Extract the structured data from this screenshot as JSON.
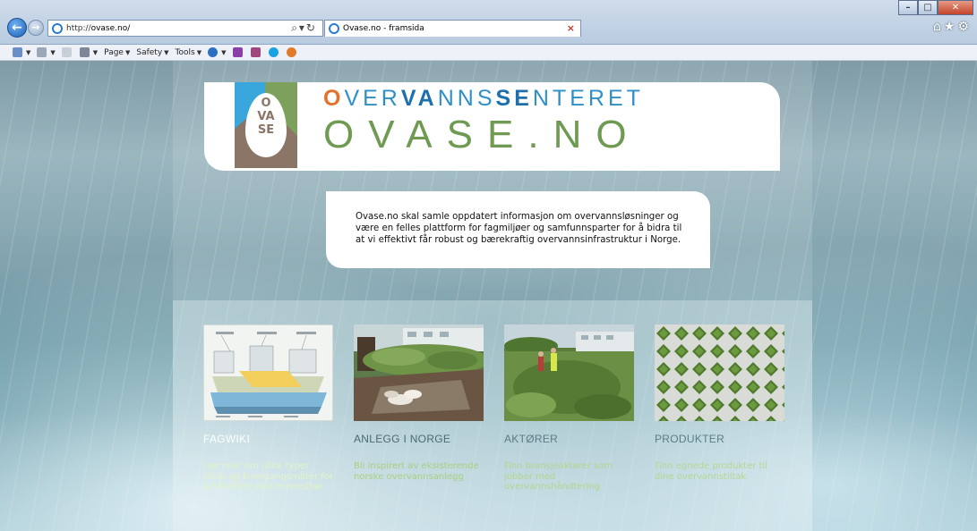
{
  "browser": {
    "url_prefix": "http://",
    "url_host": "ovase.no/",
    "tab_title": "Ovase.no - framsida",
    "toolbar": {
      "page": "Page",
      "safety": "Safety",
      "tools": "Tools"
    }
  },
  "site": {
    "logo_letters": [
      "O",
      "VA",
      "SE"
    ],
    "title_parts": [
      "O",
      "VER",
      "VA",
      "NNS",
      "SE",
      "NTERET"
    ],
    "domain": "OVASE.NO",
    "intro": "Ovase.no skal samle oppdatert informasjon om overvannsløsninger og være en felles plattform for fagmiljøer og samfunnsparter for å bidra til at vi effektivt får robust og bærekraftig overvannsinfrastruktur i Norge.",
    "tiles": [
      {
        "title": "FAGWIKI",
        "text": "Lær mer om ulike typer tiltak og framgangsmåter for å håndtere ekstremnedbør",
        "title_color": "#ffffff",
        "text_color": "#e4f3c8"
      },
      {
        "title": "ANLEGG I NORGE",
        "text": "Bli inspirert av eksisterende norske overvannsanlegg",
        "title_color": "#4c6a72",
        "text_color": "#a9cf80"
      },
      {
        "title": "AKTØRER",
        "text": "Finn bransjeaktører som jobber med overvannshåndtering",
        "title_color": "#5e7b84",
        "text_color": "#b4d58f"
      },
      {
        "title": "PRODUKTER",
        "text": "Finn egnede produkter til dine overvannstiltak",
        "title_color": "#5b7d86",
        "text_color": "#b6d793"
      }
    ]
  }
}
